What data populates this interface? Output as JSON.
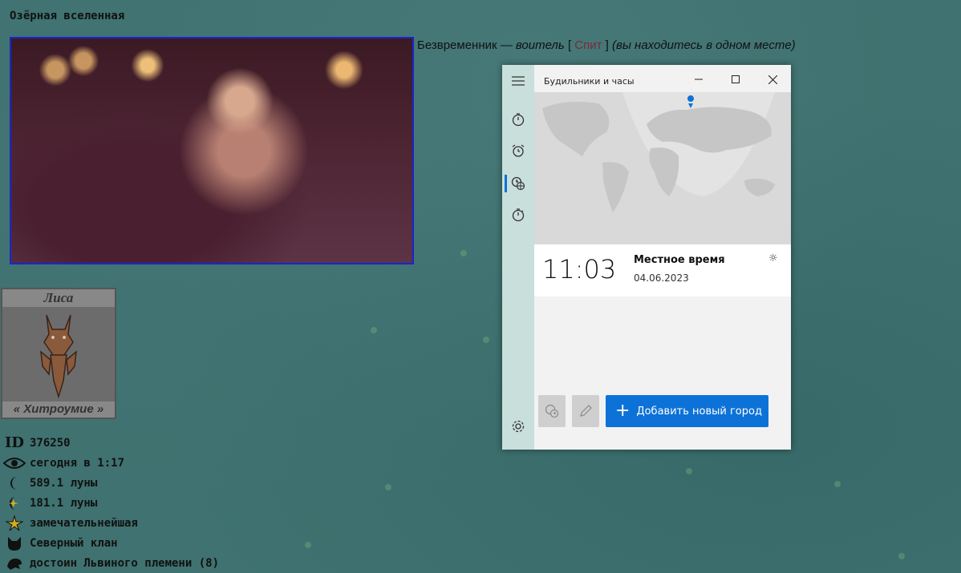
{
  "site": {
    "page_title": "Озёрная вселенная",
    "header": {
      "name": "Безвременник",
      "dash": " — ",
      "role": "воитель",
      "bracket_open": " [ ",
      "status": "Спит",
      "bracket_close": " ] ",
      "location": "(вы находитесь в одном месте)"
    },
    "clan_card": {
      "name": "Лиса",
      "trait": "« Хитроумие »"
    },
    "stats": [
      {
        "icon": "id-icon",
        "value": "376250"
      },
      {
        "icon": "eye-icon",
        "value": "сегодня в 1:17"
      },
      {
        "icon": "moon-icon",
        "value": "589.1 луны"
      },
      {
        "icon": "moon-star-icon",
        "value": "181.1 луны"
      },
      {
        "icon": "star-rank-icon",
        "value": "замечательнейшая"
      },
      {
        "icon": "cat-head-icon",
        "value": "Северный клан"
      },
      {
        "icon": "lion-icon",
        "value": "достоин Львиного племени (8)"
      }
    ]
  },
  "app": {
    "title": "Будильники и часы",
    "clock": {
      "time": "11:03",
      "label": "Местное время",
      "date": "04.06.2023"
    },
    "add_button_label": "Добавить новый город"
  },
  "colors": {
    "accent": "#0d72d7",
    "nav_bg": "#c9dfdb",
    "photo_border": "#1a24d0"
  }
}
